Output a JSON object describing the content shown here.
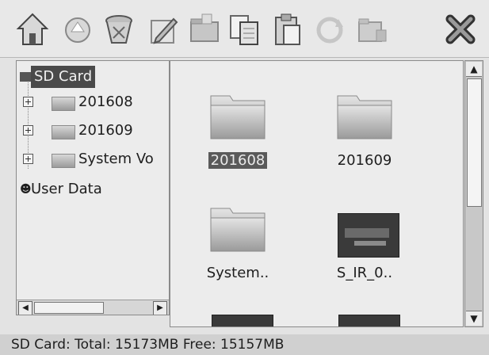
{
  "toolbar": {
    "icons": [
      "home-icon",
      "up-icon",
      "recycle-icon",
      "edit-icon",
      "folder-icon",
      "copy-icon",
      "paste-icon",
      "refresh-icon",
      "folder-options-icon",
      "close-icon"
    ]
  },
  "tree": {
    "root": "SD Card",
    "children": [
      {
        "label": "201608"
      },
      {
        "label": "201609"
      },
      {
        "label": "System Vo"
      }
    ],
    "other_root": "User Data"
  },
  "files": [
    {
      "name": "201608",
      "type": "folder",
      "selected": true
    },
    {
      "name": "201609",
      "type": "folder",
      "selected": false
    },
    {
      "name": "System..",
      "type": "folder",
      "selected": false
    },
    {
      "name": "S_IR_0..",
      "type": "image",
      "selected": false
    }
  ],
  "status": {
    "text": "SD Card: Total: 15173MB  Free: 15157MB"
  }
}
